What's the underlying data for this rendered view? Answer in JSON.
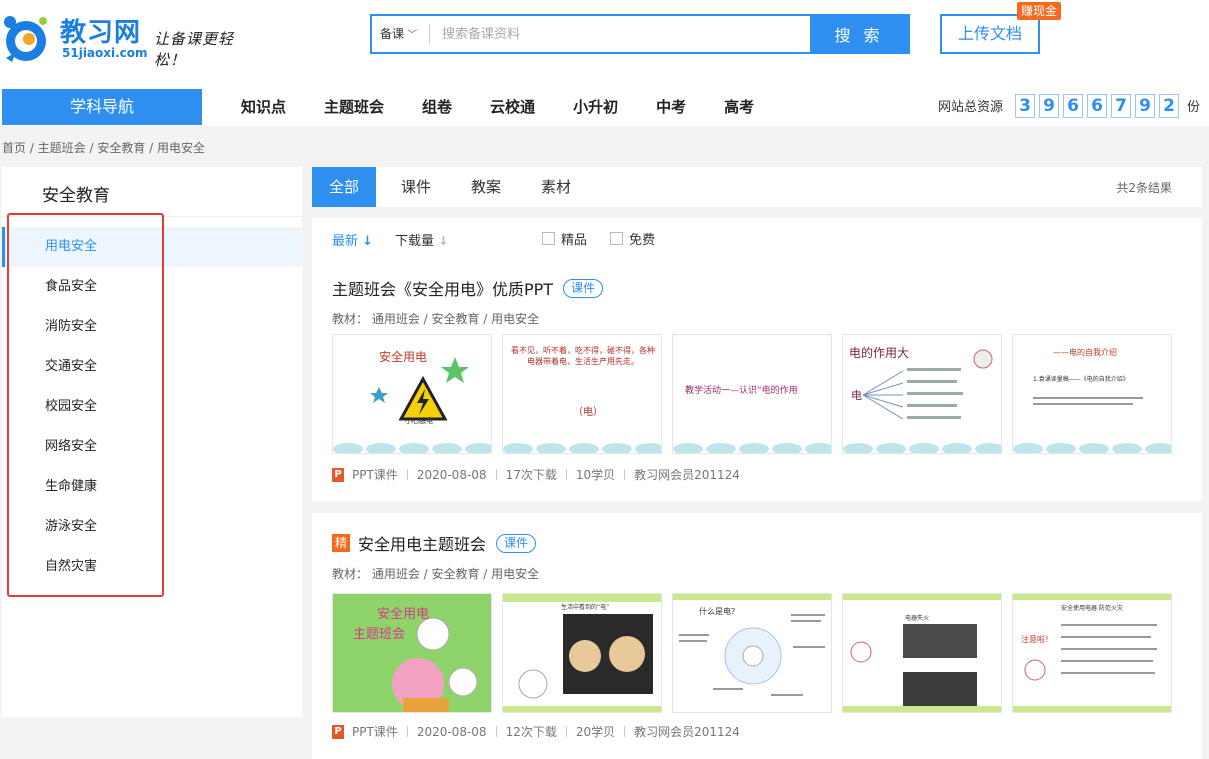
{
  "header": {
    "logo_name": "教习网",
    "logo_domain": "51jiaoxi.com",
    "slogan": "让备课更轻松！",
    "search_category": "备课",
    "search_placeholder": "搜索备课资料",
    "search_button": "搜 索",
    "upload_button": "上传文档",
    "upload_badge": "赚现金"
  },
  "nav": {
    "subject_nav": "学科导航",
    "links": [
      "知识点",
      "主题班会",
      "组卷",
      "云校通",
      "小升初",
      "中考",
      "高考"
    ],
    "resource_label": "网站总资源",
    "resource_digits": [
      "3",
      "9",
      "6",
      "6",
      "7",
      "9",
      "2"
    ],
    "resource_unit": "份"
  },
  "breadcrumb": "首页 / 主题班会 / 安全教育 / 用电安全",
  "sidebar": {
    "title": "安全教育",
    "items": [
      "用电安全",
      "食品安全",
      "消防安全",
      "交通安全",
      "校园安全",
      "网络安全",
      "生命健康",
      "游泳安全",
      "自然灾害"
    ],
    "active_index": 0
  },
  "tabs": {
    "items": [
      "全部",
      "课件",
      "教案",
      "素材"
    ],
    "active_index": 0,
    "result_count": "共2条结果"
  },
  "filters": {
    "sort_latest": "最新",
    "sort_downloads": "下载量",
    "check_premium": "精品",
    "check_free": "免费"
  },
  "results": [
    {
      "title": "主题班会《安全用电》优质PPT",
      "tag": "课件",
      "premium": false,
      "path": "教材： 通用班会 / 安全教育 / 用电安全",
      "thumb_texts": [
        "安全用电",
        "小心触电",
        "看不见，听不着，吃不得，碰不得，各种电器带着电，生活生产用先走。",
        "（电）",
        "教学活动一—认识“电的作用",
        "电的作用大",
        "电",
        "——电的自我介绍",
        "1.袁诵读量稿——《电的自我介绍》"
      ],
      "file_type": "PPT课件",
      "date": "2020-08-08",
      "downloads": "17次下载",
      "price": "10学贝",
      "author": "教习网会员201124"
    },
    {
      "title": "安全用电主题班会",
      "tag": "课件",
      "premium": true,
      "premium_label": "精",
      "path": "教材： 通用班会 / 安全教育 / 用电安全",
      "thumb_texts": [
        "安全用电",
        "主题班会",
        "生活中看到的“电”",
        "什么是电？",
        "电器失火",
        "注意啦！",
        "安全使用电器 防范火灾"
      ],
      "file_type": "PPT课件",
      "date": "2020-08-08",
      "downloads": "12次下载",
      "price": "20学贝",
      "author": "教习网会员201124"
    }
  ],
  "colors": {
    "brand_blue": "#2e8ff0",
    "badge_orange": "#f46a1a",
    "highlight_red": "#e23b3b"
  }
}
